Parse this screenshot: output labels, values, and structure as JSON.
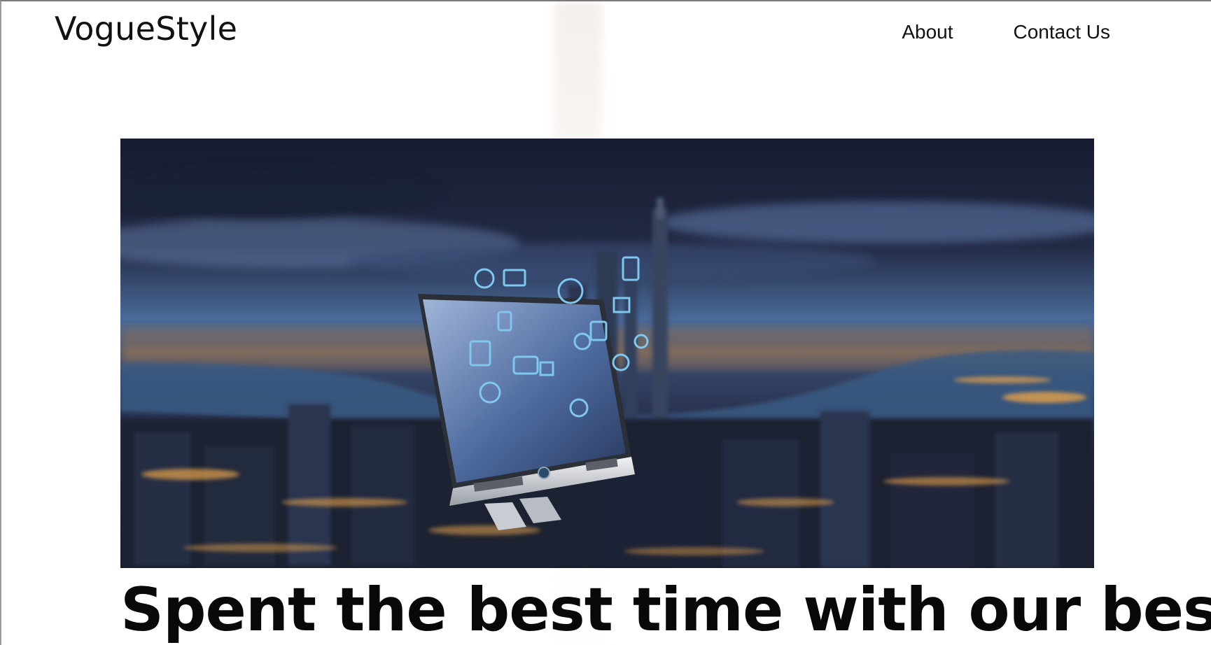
{
  "header": {
    "logo_text": "VogueStyle",
    "nav": [
      {
        "label": "About"
      },
      {
        "label": "Contact Us"
      }
    ]
  },
  "hero": {
    "image_description_icon": "computer-screen-with-app-icons",
    "headline": "Spent the best time with our best"
  },
  "colors": {
    "text": "#111111",
    "hero_sky_dark": "#1a1f35",
    "hero_sky_mid": "#3d5a8a",
    "city_lights": "#e6a24a",
    "water": "#2e4668",
    "icon_blue": "#7fc7ee"
  }
}
